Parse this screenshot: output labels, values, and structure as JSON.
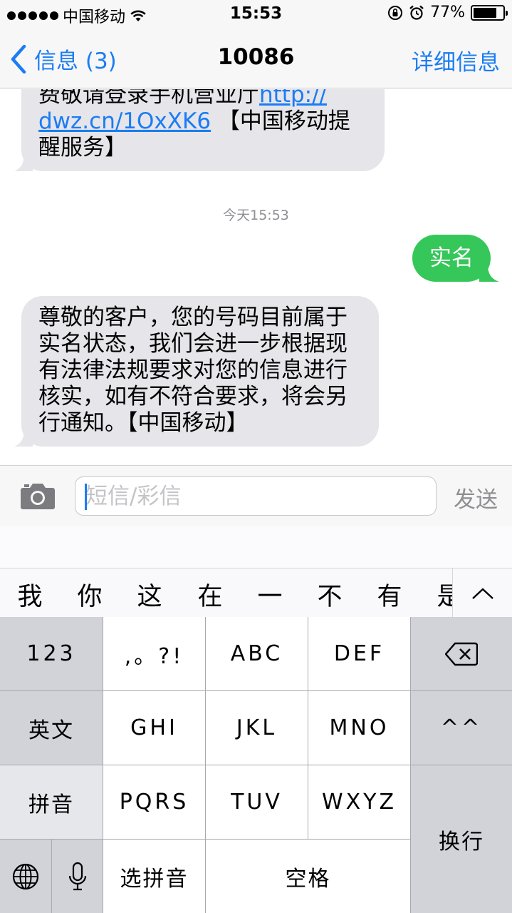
{
  "status_bar": {
    "carrier": "中国移动",
    "time": "15:53",
    "battery_percent": "77%",
    "battery_level": 0.77
  },
  "nav": {
    "back_label": "信息 (3)",
    "title": "10086",
    "detail_label": "详细信息"
  },
  "messages": {
    "msg1_line1": "费敬请登录手机营业厅",
    "msg1_link_part1": "http://",
    "msg1_link_part2": "dwz.cn/1OxXK6",
    "msg1_after_link": " 【中国移动提",
    "msg1_line3": "醒服务】",
    "timestamp": "今天15:53",
    "sent_text": "实名",
    "msg2_lines": [
      "尊敬的客户，您的号码目前属于",
      "实名状态，我们会进一步根据现",
      "有法律法规要求对您的信息进行",
      "核实，如有不符合要求，将会另",
      "行通知。【中国移动】"
    ]
  },
  "input": {
    "placeholder": "短信/彩信",
    "value": "",
    "send_label": "发送"
  },
  "candidates": [
    "我",
    "你",
    "这",
    "在",
    "一",
    "不",
    "有",
    "是"
  ],
  "keyboard": {
    "key_123": "123",
    "key_punct": ",。?!",
    "key_abc": "ABC",
    "key_def": "DEF",
    "key_english": "英文",
    "key_ghi": "GHI",
    "key_jkl": "JKL",
    "key_mno": "MNO",
    "key_emoticon": "^^",
    "key_pinyin": "拼音",
    "key_pqrs": "PQRS",
    "key_tuv": "TUV",
    "key_wxyz": "WXYZ",
    "key_return": "换行",
    "key_select_pinyin": "选拼音",
    "key_space": "空格"
  },
  "colors": {
    "accent": "#1b7cf3",
    "sent_bubble": "#35c759",
    "received_bubble": "#e5e5ea"
  }
}
